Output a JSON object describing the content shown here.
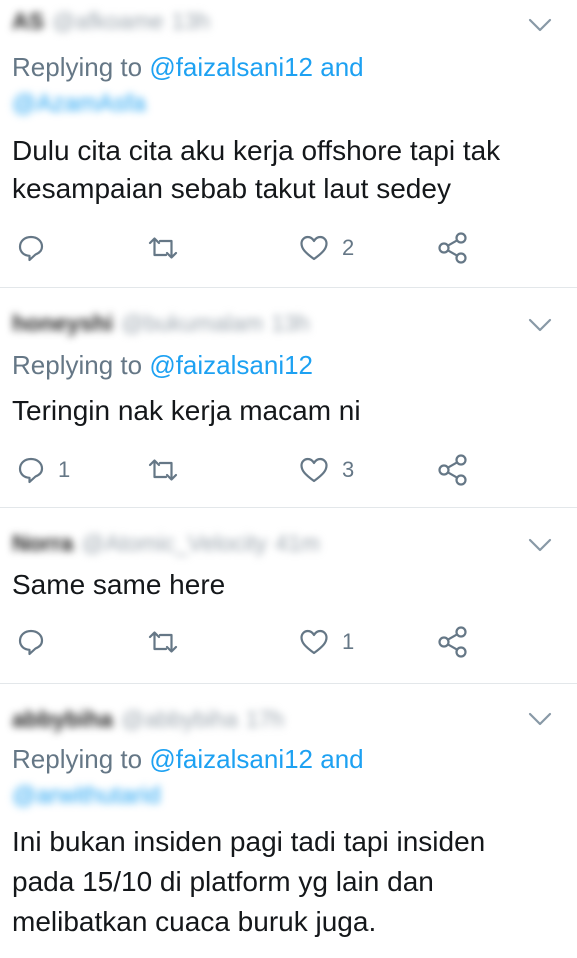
{
  "tweets": [
    {
      "author_name": "AS",
      "author_handle": "@afkoame",
      "time": "13h",
      "replying_prefix": "Replying to ",
      "replying_mention": "@faizalsani12",
      "replying_suffix": " and",
      "replying_second": "@AzamAsfa",
      "text": "Dulu cita cita aku kerja offshore tapi tak kesampaian sebab takut laut sedey",
      "reply_count": "",
      "retweet_count": "",
      "like_count": "2"
    },
    {
      "author_name": "honeyshi",
      "author_handle": "@bukumalam",
      "time": "13h",
      "replying_prefix": "Replying to ",
      "replying_mention": "@faizalsani12",
      "replying_suffix": "",
      "replying_second": "",
      "text": "Teringin nak kerja macam ni",
      "reply_count": "1",
      "retweet_count": "",
      "like_count": "3"
    },
    {
      "author_name": "Norra",
      "author_handle": "@Atomic_Velocity",
      "time": "41m",
      "replying_prefix": "",
      "replying_mention": "",
      "replying_suffix": "",
      "replying_second": "",
      "text": "Same same here",
      "reply_count": "",
      "retweet_count": "",
      "like_count": "1"
    },
    {
      "author_name": "abbybiha",
      "author_handle": "@abbybiha",
      "time": "17h",
      "replying_prefix": "Replying to ",
      "replying_mention": "@faizalsani12",
      "replying_suffix": " and",
      "replying_second": "@arwithutarid",
      "text": "Ini bukan insiden pagi tadi tapi insiden pada 15/10 di platform yg lain dan melibatkan cuaca buruk juga.",
      "reply_count": "",
      "retweet_count": "",
      "like_count": ""
    }
  ],
  "icons": {
    "reply": "reply-icon",
    "retweet": "retweet-icon",
    "like": "heart-icon",
    "share": "share-icon",
    "more": "chevron-down-icon"
  },
  "colors": {
    "mention": "#1da1f2",
    "secondary": "#657786",
    "icon": "#657786",
    "divider": "#e3e7ea"
  }
}
